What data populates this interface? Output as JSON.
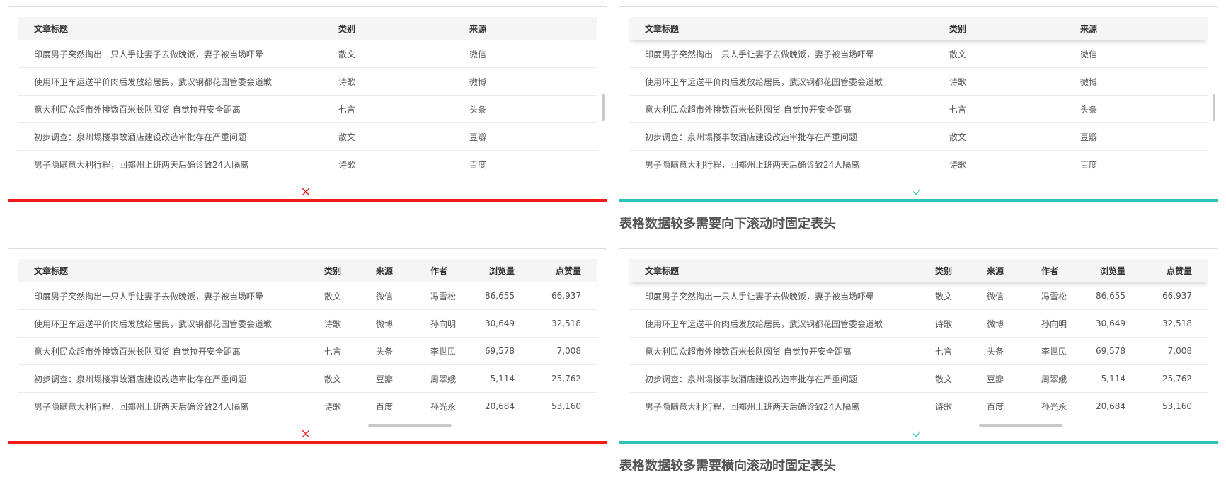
{
  "colors": {
    "bad": "#ef1b1b",
    "good": "#2bc4b6"
  },
  "icons": {
    "bad": "cross-icon",
    "good": "check-icon"
  },
  "headers_small": [
    "文章标题",
    "类别",
    "来源"
  ],
  "headers_wide": [
    "文章标题",
    "类别",
    "来源",
    "作者",
    "浏览量",
    "点赞量"
  ],
  "rows": [
    {
      "title": "印度男子突然掏出一只人手让妻子去做晚饭，妻子被当场吓晕",
      "cat": "散文",
      "src": "微信",
      "author": "冯雪松",
      "views": "86,655",
      "likes": "66,937"
    },
    {
      "title": "使用环卫车运送平价肉后发放给居民，武汉钢都花园管委会道歉",
      "cat": "诗歌",
      "src": "微博",
      "author": "孙向明",
      "views": "30,649",
      "likes": "32,518"
    },
    {
      "title": "意大利民众超市外排数百米长队囤货 自觉拉开安全距离",
      "cat": "七言",
      "src": "头条",
      "author": "李世民",
      "views": "69,578",
      "likes": "7,008"
    },
    {
      "title": "初步调查：泉州塌楼事故酒店建设改造审批存在严重问题",
      "cat": "散文",
      "src": "豆瓣",
      "author": "周翠娥",
      "views": "5,114",
      "likes": "25,762"
    },
    {
      "title": "男子隐瞒意大利行程，回郑州上班两天后确诊致24人隔离",
      "cat": "诗歌",
      "src": "百度",
      "author": "孙光永",
      "views": "20,684",
      "likes": "53,160"
    }
  ],
  "captions": {
    "vertical": "表格数据较多需要向下滚动时固定表头",
    "horizontal": "表格数据较多需要横向滚动时固定表头"
  }
}
